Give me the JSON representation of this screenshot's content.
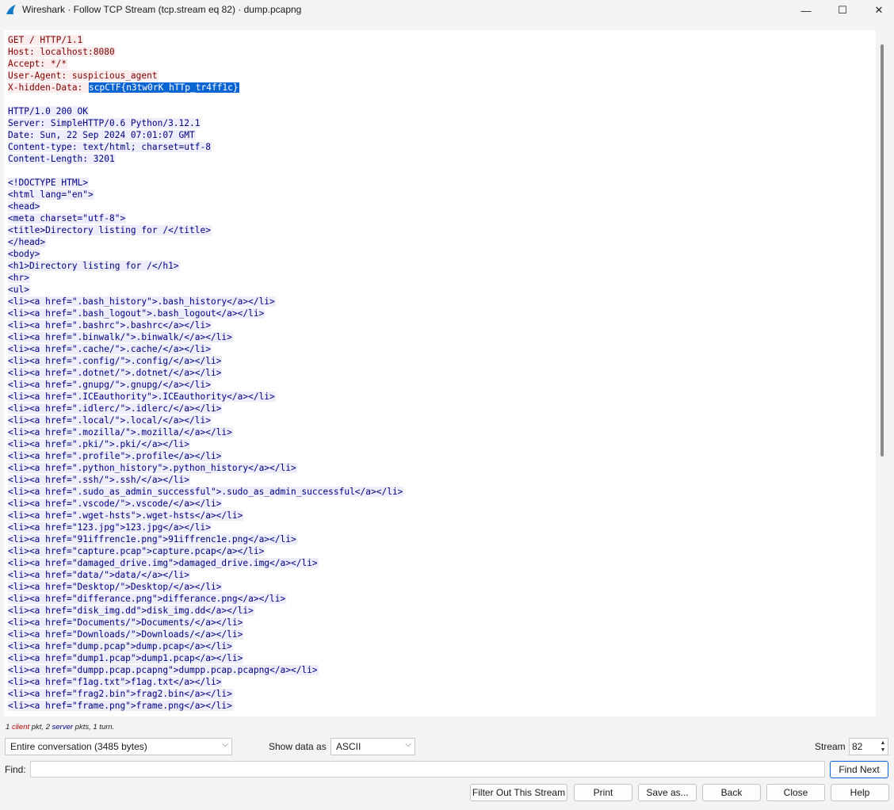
{
  "window": {
    "title": "Wireshark · Follow TCP Stream (tcp.stream eq 82) · dump.pcapng",
    "minimize_glyph": "—",
    "maximize_glyph": "☐",
    "close_glyph": "✕"
  },
  "stream": {
    "lines": [
      {
        "dir": "client",
        "text": "GET / HTTP/1.1"
      },
      {
        "dir": "client",
        "text": "Host: localhost:8080"
      },
      {
        "dir": "client",
        "text": "Accept: */*"
      },
      {
        "dir": "client",
        "text": "User-Agent: suspicious_agent"
      },
      {
        "dir": "client",
        "text": "X-hidden-Data: ",
        "selected": "scpCTF{n3tw0rK_hTTp_tr4ff1c}"
      },
      {
        "dir": "blank",
        "text": ""
      },
      {
        "dir": "server",
        "text": "HTTP/1.0 200 OK"
      },
      {
        "dir": "server",
        "text": "Server: SimpleHTTP/0.6 Python/3.12.1"
      },
      {
        "dir": "server",
        "text": "Date: Sun, 22 Sep 2024 07:01:07 GMT"
      },
      {
        "dir": "server",
        "text": "Content-type: text/html; charset=utf-8"
      },
      {
        "dir": "server",
        "text": "Content-Length: 3201"
      },
      {
        "dir": "blank",
        "text": ""
      },
      {
        "dir": "server",
        "text": "<!DOCTYPE HTML>"
      },
      {
        "dir": "server",
        "text": "<html lang=\"en\">"
      },
      {
        "dir": "server",
        "text": "<head>"
      },
      {
        "dir": "server",
        "text": "<meta charset=\"utf-8\">"
      },
      {
        "dir": "server",
        "text": "<title>Directory listing for /</title>"
      },
      {
        "dir": "server",
        "text": "</head>"
      },
      {
        "dir": "server",
        "text": "<body>"
      },
      {
        "dir": "server",
        "text": "<h1>Directory listing for /</h1>"
      },
      {
        "dir": "server",
        "text": "<hr>"
      },
      {
        "dir": "server",
        "text": "<ul>"
      },
      {
        "dir": "server",
        "text": "<li><a href=\".bash_history\">.bash_history</a></li>"
      },
      {
        "dir": "server",
        "text": "<li><a href=\".bash_logout\">.bash_logout</a></li>"
      },
      {
        "dir": "server",
        "text": "<li><a href=\".bashrc\">.bashrc</a></li>"
      },
      {
        "dir": "server",
        "text": "<li><a href=\".binwalk/\">.binwalk/</a></li>"
      },
      {
        "dir": "server",
        "text": "<li><a href=\".cache/\">.cache/</a></li>"
      },
      {
        "dir": "server",
        "text": "<li><a href=\".config/\">.config/</a></li>"
      },
      {
        "dir": "server",
        "text": "<li><a href=\".dotnet/\">.dotnet/</a></li>"
      },
      {
        "dir": "server",
        "text": "<li><a href=\".gnupg/\">.gnupg/</a></li>"
      },
      {
        "dir": "server",
        "text": "<li><a href=\".ICEauthority\">.ICEauthority</a></li>"
      },
      {
        "dir": "server",
        "text": "<li><a href=\".idlerc/\">.idlerc/</a></li>"
      },
      {
        "dir": "server",
        "text": "<li><a href=\".local/\">.local/</a></li>"
      },
      {
        "dir": "server",
        "text": "<li><a href=\".mozilla/\">.mozilla/</a></li>"
      },
      {
        "dir": "server",
        "text": "<li><a href=\".pki/\">.pki/</a></li>"
      },
      {
        "dir": "server",
        "text": "<li><a href=\".profile\">.profile</a></li>"
      },
      {
        "dir": "server",
        "text": "<li><a href=\".python_history\">.python_history</a></li>"
      },
      {
        "dir": "server",
        "text": "<li><a href=\".ssh/\">.ssh/</a></li>"
      },
      {
        "dir": "server",
        "text": "<li><a href=\".sudo_as_admin_successful\">.sudo_as_admin_successful</a></li>"
      },
      {
        "dir": "server",
        "text": "<li><a href=\".vscode/\">.vscode/</a></li>"
      },
      {
        "dir": "server",
        "text": "<li><a href=\".wget-hsts\">.wget-hsts</a></li>"
      },
      {
        "dir": "server",
        "text": "<li><a href=\"123.jpg\">123.jpg</a></li>"
      },
      {
        "dir": "server",
        "text": "<li><a href=\"91iffrenc1e.png\">91iffrenc1e.png</a></li>"
      },
      {
        "dir": "server",
        "text": "<li><a href=\"capture.pcap\">capture.pcap</a></li>"
      },
      {
        "dir": "server",
        "text": "<li><a href=\"damaged_drive.img\">damaged_drive.img</a></li>"
      },
      {
        "dir": "server",
        "text": "<li><a href=\"data/\">data/</a></li>"
      },
      {
        "dir": "server",
        "text": "<li><a href=\"Desktop/\">Desktop/</a></li>"
      },
      {
        "dir": "server",
        "text": "<li><a href=\"differance.png\">differance.png</a></li>"
      },
      {
        "dir": "server",
        "text": "<li><a href=\"disk_img.dd\">disk_img.dd</a></li>"
      },
      {
        "dir": "server",
        "text": "<li><a href=\"Documents/\">Documents/</a></li>"
      },
      {
        "dir": "server",
        "text": "<li><a href=\"Downloads/\">Downloads/</a></li>"
      },
      {
        "dir": "server",
        "text": "<li><a href=\"dump.pcap\">dump.pcap</a></li>"
      },
      {
        "dir": "server",
        "text": "<li><a href=\"dump1.pcap\">dump1.pcap</a></li>"
      },
      {
        "dir": "server",
        "text": "<li><a href=\"dumpp.pcap.pcapng\">dumpp.pcap.pcapng</a></li>"
      },
      {
        "dir": "server",
        "text": "<li><a href=\"f1ag.txt\">f1ag.txt</a></li>"
      },
      {
        "dir": "server",
        "text": "<li><a href=\"frag2.bin\">frag2.bin</a></li>"
      },
      {
        "dir": "server",
        "text": "<li><a href=\"frame.png\">frame.png</a></li>"
      }
    ],
    "colors": {
      "client_fg": "#7d0000",
      "client_bg": "#fbeded",
      "server_fg": "#00007d",
      "server_bg": "#ededfb",
      "selection": "#0a64d2"
    }
  },
  "summary": {
    "client_count": "1",
    "client_word": "client",
    "rest": " pkt, 2 ",
    "server_word": "server",
    "rest2": " pkts, 1 turn."
  },
  "controls": {
    "conversation_value": "Entire conversation (3485 bytes)",
    "show_data_label": "Show data as",
    "show_data_value": "ASCII",
    "stream_label": "Stream",
    "stream_value": "82"
  },
  "find": {
    "label": "Find:",
    "value": "",
    "find_next_label": "Find Next"
  },
  "buttons": {
    "filter_out": "Filter Out This Stream",
    "print": "Print",
    "save_as": "Save as...",
    "back": "Back",
    "close": "Close",
    "help": "Help"
  }
}
